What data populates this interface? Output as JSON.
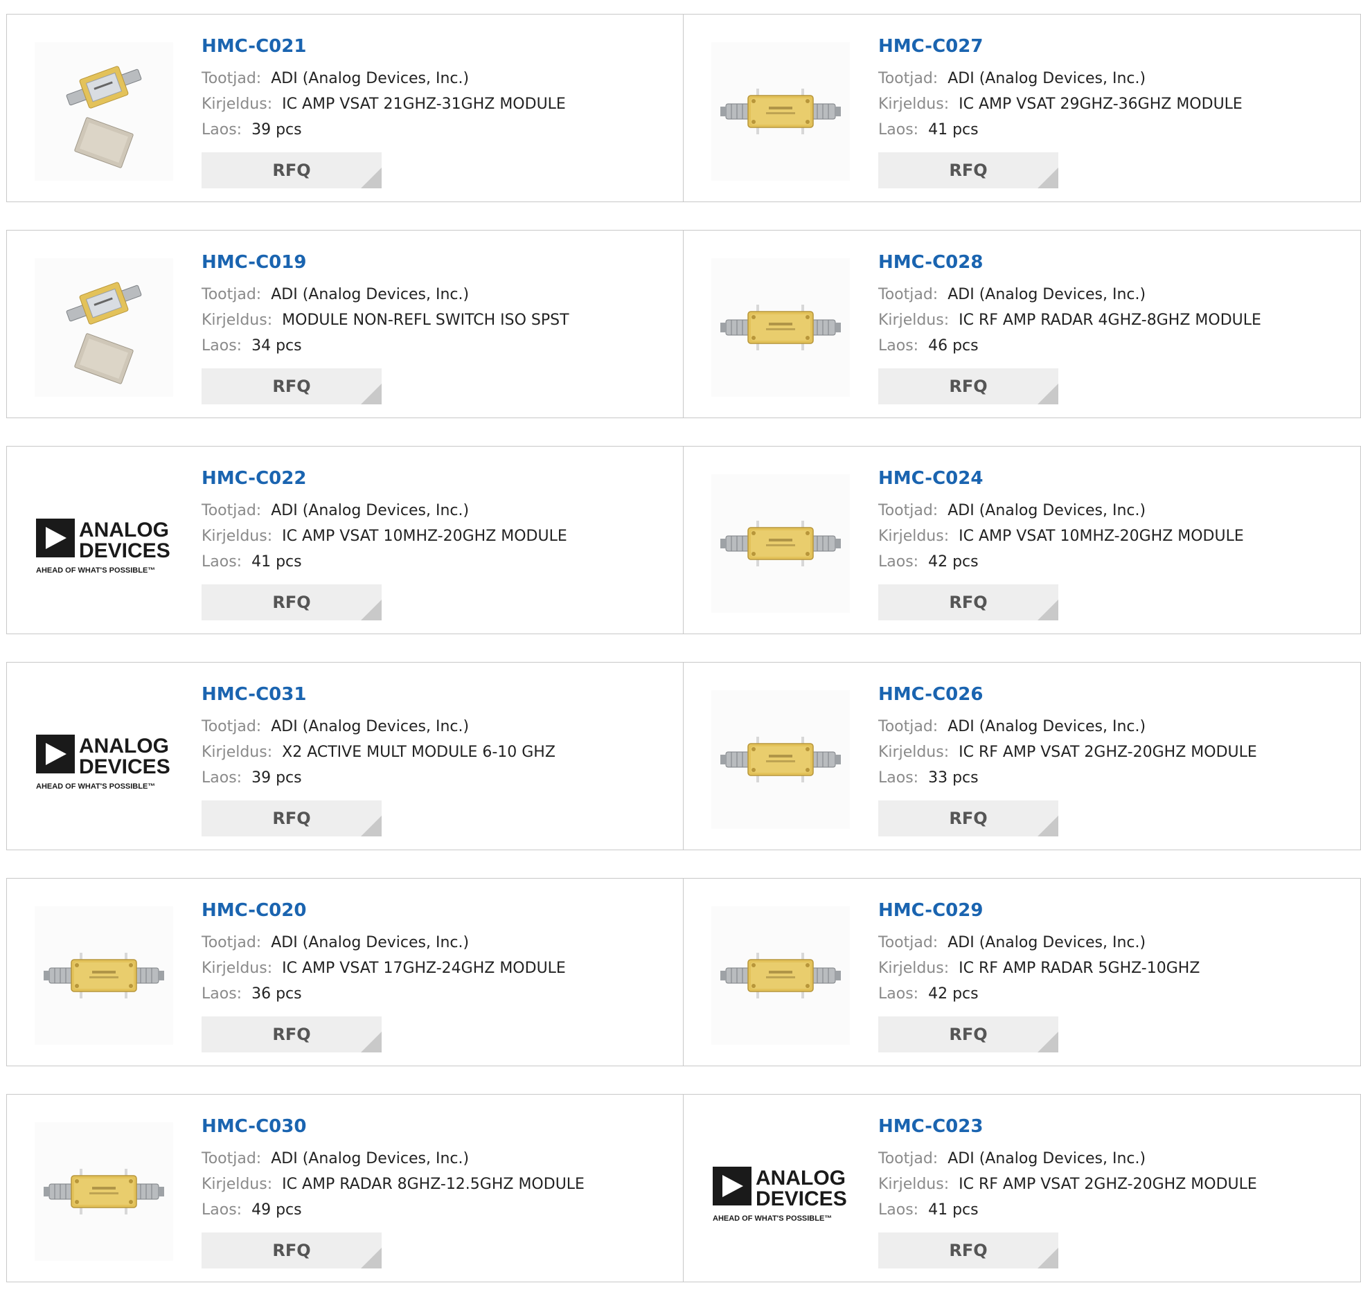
{
  "labels": {
    "manufacturer": "Tootjad:",
    "description": "Kirjeldus:",
    "stock": "Laos:",
    "rfq": "RFQ"
  },
  "products": [
    {
      "pn": "HMC-C021",
      "manufacturer": "ADI (Analog Devices, Inc.)",
      "description": "IC AMP VSAT 21GHZ-31GHZ MODULE",
      "stock": "39 pcs",
      "image": "module-with-lid-photo"
    },
    {
      "pn": "HMC-C027",
      "manufacturer": "ADI (Analog Devices, Inc.)",
      "description": "IC AMP VSAT 29GHZ-36GHZ MODULE",
      "stock": "41 pcs",
      "image": "gold-module-photo"
    },
    {
      "pn": "HMC-C019",
      "manufacturer": "ADI (Analog Devices, Inc.)",
      "description": "MODULE NON-REFL SWITCH ISO SPST",
      "stock": "34 pcs",
      "image": "module-with-lid-photo"
    },
    {
      "pn": "HMC-C028",
      "manufacturer": "ADI (Analog Devices, Inc.)",
      "description": "IC RF AMP RADAR 4GHZ-8GHZ MODULE",
      "stock": "46 pcs",
      "image": "gold-module-photo"
    },
    {
      "pn": "HMC-C022",
      "manufacturer": "ADI (Analog Devices, Inc.)",
      "description": "IC AMP VSAT 10MHZ-20GHZ MODULE",
      "stock": "41 pcs",
      "image": "analog-devices-logo"
    },
    {
      "pn": "HMC-C024",
      "manufacturer": "ADI (Analog Devices, Inc.)",
      "description": "IC AMP VSAT 10MHZ-20GHZ MODULE",
      "stock": "42 pcs",
      "image": "gold-module-photo"
    },
    {
      "pn": "HMC-C031",
      "manufacturer": "ADI (Analog Devices, Inc.)",
      "description": "X2 ACTIVE MULT MODULE 6-10 GHZ",
      "stock": "39 pcs",
      "image": "analog-devices-logo"
    },
    {
      "pn": "HMC-C026",
      "manufacturer": "ADI (Analog Devices, Inc.)",
      "description": "IC RF AMP VSAT 2GHZ-20GHZ MODULE",
      "stock": "33 pcs",
      "image": "gold-module-photo"
    },
    {
      "pn": "HMC-C020",
      "manufacturer": "ADI (Analog Devices, Inc.)",
      "description": "IC AMP VSAT 17GHZ-24GHZ MODULE",
      "stock": "36 pcs",
      "image": "gold-module-photo"
    },
    {
      "pn": "HMC-C029",
      "manufacturer": "ADI (Analog Devices, Inc.)",
      "description": "IC RF AMP RADAR 5GHZ-10GHZ",
      "stock": "42 pcs",
      "image": "gold-module-photo"
    },
    {
      "pn": "HMC-C030",
      "manufacturer": "ADI (Analog Devices, Inc.)",
      "description": "IC AMP RADAR 8GHZ-12.5GHZ MODULE",
      "stock": "49 pcs",
      "image": "gold-module-photo"
    },
    {
      "pn": "HMC-C023",
      "manufacturer": "ADI (Analog Devices, Inc.)",
      "description": "IC RF AMP VSAT 2GHZ-20GHZ MODULE",
      "stock": "41 pcs",
      "image": "analog-devices-logo"
    }
  ],
  "logo": {
    "line1": "ANALOG",
    "line2": "DEVICES",
    "tagline": "AHEAD OF WHAT'S POSSIBLE™"
  },
  "colors": {
    "part_number": "#1a64b0",
    "label": "#8a8a8a",
    "button_bg": "#eeeeee",
    "gold": "#e3c25a"
  }
}
